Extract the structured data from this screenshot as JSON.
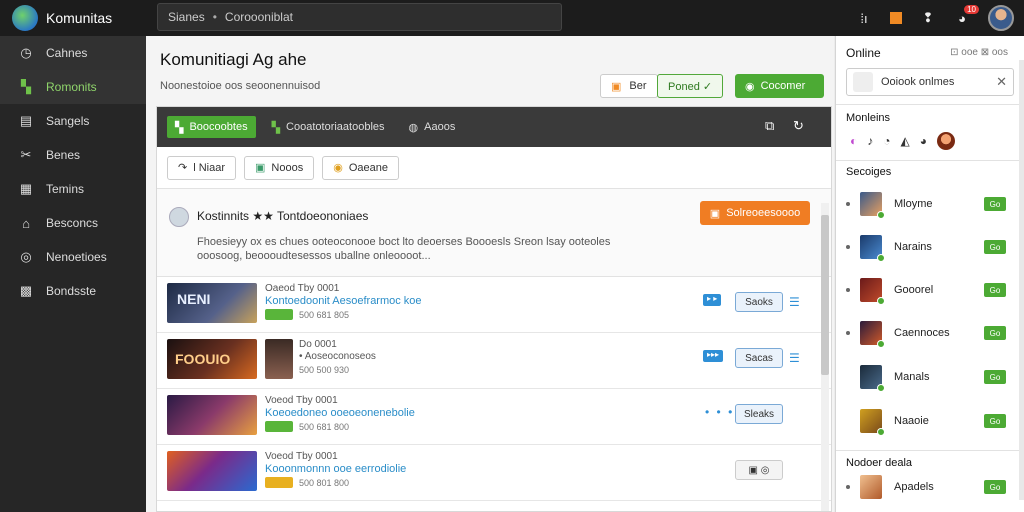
{
  "app": {
    "title": "Komunitas"
  },
  "search": {
    "crumb1": "Sianes",
    "crumb2": "Coroooniblat"
  },
  "top_icons": [
    "settings-icon",
    "box-icon",
    "help-icon",
    "bell-icon"
  ],
  "notifications": {
    "count": "10"
  },
  "sidebar": {
    "items": [
      {
        "label": "Cahnes",
        "icon": "clock-icon",
        "glyph": "◷"
      },
      {
        "label": "Romonits",
        "icon": "community-icon",
        "glyph": "▚"
      },
      {
        "label": "Sangels",
        "icon": "groups-icon",
        "glyph": "▤"
      },
      {
        "label": "Benes",
        "icon": "tools-icon",
        "glyph": "✂"
      },
      {
        "label": "Temins",
        "icon": "document-icon",
        "glyph": "▦"
      },
      {
        "label": "Besconcs",
        "icon": "store-icon",
        "glyph": "⌂"
      },
      {
        "label": "Nenoetioes",
        "icon": "gamepad-icon",
        "glyph": "◎"
      },
      {
        "label": "Bondsste",
        "icon": "chat-icon",
        "glyph": "▩"
      }
    ]
  },
  "main": {
    "title": "Komunitiagi Ag ahe",
    "subtitle": "Noonestoioe oos seoonennuisod",
    "btn_plain": "Ber",
    "btn_outline": "Poned ✓",
    "btn_green": "Cocomer"
  },
  "panel": {
    "tabs": [
      "Boocoobtes",
      "Cooatotoriaatoobles",
      "Aaoos"
    ],
    "filters": [
      "l Niaar",
      "Nooos",
      "Oaeane"
    ],
    "post": {
      "author": "Kostinnits ★★ Tontdoeononiaes",
      "text": "Fhoesieyy ox es chues ooteoconooe boct lto deoerses Boooesls Sreon lsay ooteoles ooosoog, beoooudtesessos uballne onleoooot...",
      "button": "Solreoeesoooo"
    },
    "rows": [
      {
        "thumb_text": "NENI",
        "meta": "Oaeod Tby 0001",
        "link": "Kontoedoonit Aesoefrarmoc koe",
        "stats": "500  681  805",
        "tag": "▸ ▸",
        "button": "Saoks",
        "end": "list"
      },
      {
        "thumb_text": "FOOUIO",
        "meta": "Do 0001",
        "link": "",
        "stats": "500  500  930",
        "sub": "• Aoseoconoseos",
        "tag": "▸▸▸",
        "button": "Sacas",
        "end": "list"
      },
      {
        "thumb_text": "",
        "meta": "Voeod Tby 0001",
        "link": "Koeoedoneo ooeoeonenebolie",
        "stats": "500  681  800",
        "tag": "",
        "button": "Sleaks",
        "end": "dots"
      },
      {
        "thumb_text": "",
        "meta": "Voeod Tby 0001",
        "link": "Kooonmonnn ooe eerrodiolie",
        "stats": "500  801  800",
        "tag": "",
        "button": "▣ ◎",
        "end": "none"
      }
    ]
  },
  "right": {
    "title": "Online",
    "links": "⊡ ooe ⊠ oos",
    "search_value": "Ooiook onlmes",
    "members_title": "Monleins",
    "members_icons": [
      "badge-icon",
      "note-icon",
      "chat-icon",
      "map-icon",
      "shield-icon"
    ],
    "friends_title": "Secoiges",
    "friends": [
      {
        "name": "Mloyme",
        "button": "Go"
      },
      {
        "name": "Narains",
        "button": "Go"
      },
      {
        "name": "Gooorel",
        "button": "Go"
      },
      {
        "name": "Caennoces",
        "button": "Go"
      },
      {
        "name": "Manals",
        "button": "Go"
      },
      {
        "name": "Naaoie",
        "button": "Go"
      }
    ],
    "deals_title": "Nodoer deala",
    "deals": [
      {
        "name": "Apadels",
        "button": "Go"
      }
    ]
  },
  "colors": {
    "accent": "#4caa34",
    "orange": "#f07d23",
    "link": "#2a8dc8",
    "topbar": "#1c1c1c",
    "sidebar": "#262626"
  }
}
